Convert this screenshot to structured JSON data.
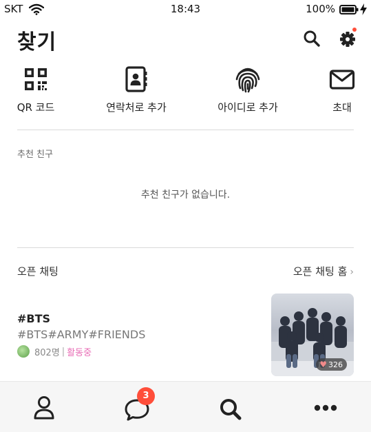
{
  "status_bar": {
    "carrier": "SKT",
    "time": "18:43",
    "battery": "100%"
  },
  "header": {
    "title": "찾기"
  },
  "actions": [
    {
      "label": "QR 코드",
      "icon": "qr-code-icon"
    },
    {
      "label": "연락처로 추가",
      "icon": "contacts-book-icon"
    },
    {
      "label": "아이디로 추가",
      "icon": "fingerprint-icon"
    },
    {
      "label": "초대",
      "icon": "envelope-icon"
    }
  ],
  "recommended": {
    "label": "추천 친구",
    "empty_message": "추천 친구가 없습니다."
  },
  "open_chat": {
    "title": "오픈 채팅",
    "home_link": "오픈 채팅 홈",
    "item": {
      "name": "#BTS",
      "tags": "#BTS#ARMY#FRIENDS",
      "members": "802명",
      "separator": "|",
      "status": "활동중",
      "likes": "326"
    }
  },
  "bottom_nav": {
    "items": [
      "friends-icon",
      "chat-bubble-icon",
      "search-icon",
      "more-icon"
    ],
    "chat_badge": "3"
  },
  "colors": {
    "badge": "#ff4e3a",
    "active_status": "#e86bb5",
    "nav_bg": "#f6f6f6"
  }
}
